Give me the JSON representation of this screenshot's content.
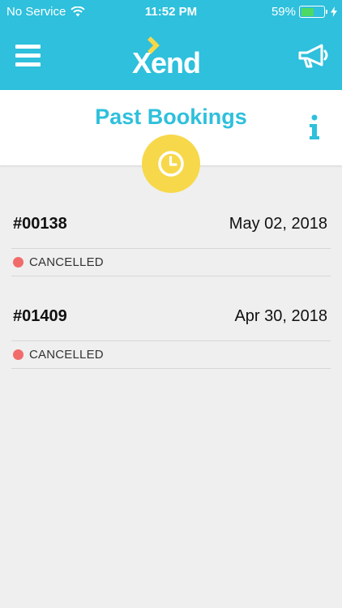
{
  "status_bar": {
    "carrier": "No Service",
    "time": "11:52 PM",
    "battery_percent": "59%",
    "battery_level": 0.59
  },
  "header": {
    "logo_text": "Xend",
    "menu_icon": "hamburger-menu-icon",
    "announcement_icon": "megaphone-icon",
    "brand_color": "#2ec0dc",
    "logo_accent": "#f7d84a"
  },
  "page": {
    "title": "Past Bookings",
    "info_icon": "info-icon",
    "badge_icon": "clock-icon",
    "badge_color": "#f7d84a"
  },
  "bookings": [
    {
      "id": "#00138",
      "date": "May 02, 2018",
      "status": "CANCELLED",
      "status_color": "#f26b6b"
    },
    {
      "id": "#01409",
      "date": "Apr 30, 2018",
      "status": "CANCELLED",
      "status_color": "#f26b6b"
    }
  ]
}
